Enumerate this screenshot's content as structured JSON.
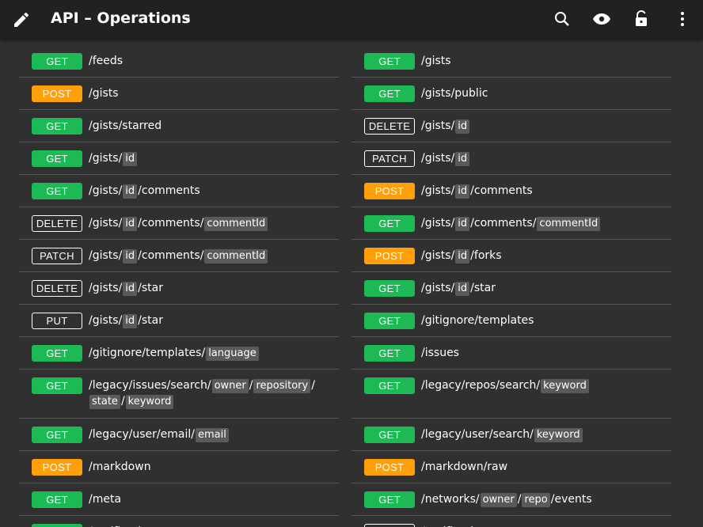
{
  "app": {
    "title": "API – Operations",
    "colors": {
      "get": "#1db954",
      "post": "#ff9f0a",
      "bg": "#303030",
      "bar": "#212121"
    },
    "icons": [
      "edit-icon",
      "dropdown-caret-icon",
      "search-icon",
      "visibility-icon",
      "lock-open-icon",
      "more-vert-icon"
    ]
  },
  "left": [
    {
      "method": "GET",
      "path": [
        "/feeds"
      ]
    },
    {
      "method": "POST",
      "path": [
        "/gists"
      ]
    },
    {
      "method": "GET",
      "path": [
        "/gists/starred"
      ]
    },
    {
      "method": "GET",
      "path": [
        "/gists/",
        {
          "p": "id"
        }
      ]
    },
    {
      "method": "GET",
      "path": [
        "/gists/",
        {
          "p": "id"
        },
        "/comments"
      ]
    },
    {
      "method": "DELETE",
      "path": [
        "/gists/",
        {
          "p": "id"
        },
        "/comments/",
        {
          "p": "commentId"
        }
      ]
    },
    {
      "method": "PATCH",
      "path": [
        "/gists/",
        {
          "p": "id"
        },
        "/comments/",
        {
          "p": "commentId"
        }
      ]
    },
    {
      "method": "DELETE",
      "path": [
        "/gists/",
        {
          "p": "id"
        },
        "/star"
      ]
    },
    {
      "method": "PUT",
      "path": [
        "/gists/",
        {
          "p": "id"
        },
        "/star"
      ]
    },
    {
      "method": "GET",
      "path": [
        "/gitignore/templates/",
        {
          "p": "language"
        }
      ]
    },
    {
      "method": "GET",
      "path": [
        "/legacy/issues/search/",
        {
          "p": "owner"
        },
        "/",
        {
          "p": "repository"
        },
        "/",
        {
          "p": "state"
        },
        "/",
        {
          "p": "keyword"
        }
      ]
    },
    {
      "method": "GET",
      "path": [
        "/legacy/user/email/",
        {
          "p": "email"
        }
      ]
    },
    {
      "method": "POST",
      "path": [
        "/markdown"
      ]
    },
    {
      "method": "GET",
      "path": [
        "/meta"
      ]
    },
    {
      "method": "GET",
      "path": [
        "/notifications"
      ]
    }
  ],
  "right": [
    {
      "method": "GET",
      "path": [
        "/gists"
      ]
    },
    {
      "method": "GET",
      "path": [
        "/gists/public"
      ]
    },
    {
      "method": "DELETE",
      "path": [
        "/gists/",
        {
          "p": "id"
        }
      ]
    },
    {
      "method": "PATCH",
      "path": [
        "/gists/",
        {
          "p": "id"
        }
      ]
    },
    {
      "method": "POST",
      "path": [
        "/gists/",
        {
          "p": "id"
        },
        "/comments"
      ]
    },
    {
      "method": "GET",
      "path": [
        "/gists/",
        {
          "p": "id"
        },
        "/comments/",
        {
          "p": "commentId"
        }
      ]
    },
    {
      "method": "POST",
      "path": [
        "/gists/",
        {
          "p": "id"
        },
        "/forks"
      ]
    },
    {
      "method": "GET",
      "path": [
        "/gists/",
        {
          "p": "id"
        },
        "/star"
      ]
    },
    {
      "method": "GET",
      "path": [
        "/gitignore/templates"
      ]
    },
    {
      "method": "GET",
      "path": [
        "/issues"
      ]
    },
    {
      "method": "GET",
      "path": [
        "/legacy/repos/search/",
        {
          "p": "keyword"
        }
      ]
    },
    {
      "method": "GET",
      "path": [
        "/legacy/user/search/",
        {
          "p": "keyword"
        }
      ]
    },
    {
      "method": "POST",
      "path": [
        "/markdown/raw"
      ]
    },
    {
      "method": "GET",
      "path": [
        "/networks/",
        {
          "p": "owner"
        },
        "/",
        {
          "p": "repo"
        },
        "/events"
      ]
    },
    {
      "method": "PUT",
      "path": [
        "/notifications"
      ]
    }
  ]
}
